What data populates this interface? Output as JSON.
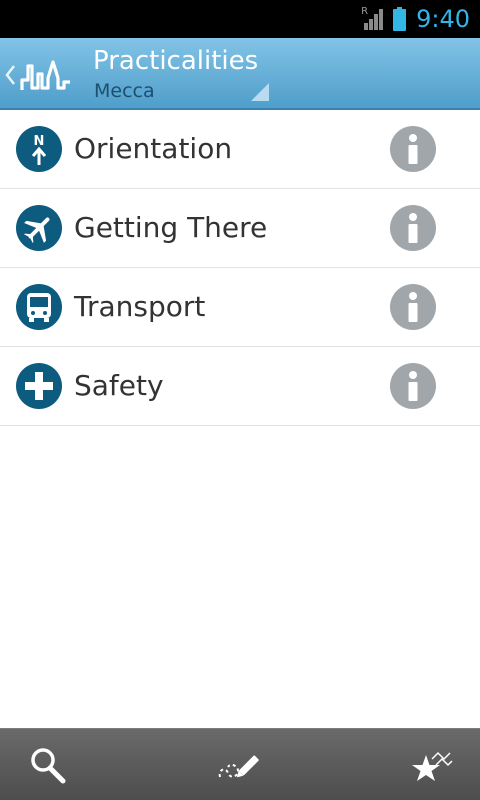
{
  "status_bar": {
    "signal_label": "R",
    "time": "9:40",
    "accent_color": "#33b5e5"
  },
  "action_bar": {
    "title": "Practicalities",
    "subtitle": "Mecca",
    "back_icon": "chevron-left-icon",
    "logo_icon": "skyline-logo-icon"
  },
  "list": {
    "items": [
      {
        "label": "Orientation",
        "icon": "compass-north-icon"
      },
      {
        "label": "Getting There",
        "icon": "airplane-icon"
      },
      {
        "label": "Transport",
        "icon": "bus-icon"
      },
      {
        "label": "Safety",
        "icon": "medical-cross-icon"
      }
    ],
    "info_icon": "info-icon",
    "icon_color": "#0d5c80",
    "info_color": "#a0a6aa"
  },
  "bottom_bar": {
    "buttons": [
      "search-icon",
      "itinerary-pen-icon",
      "favorites-stars-icon"
    ]
  }
}
